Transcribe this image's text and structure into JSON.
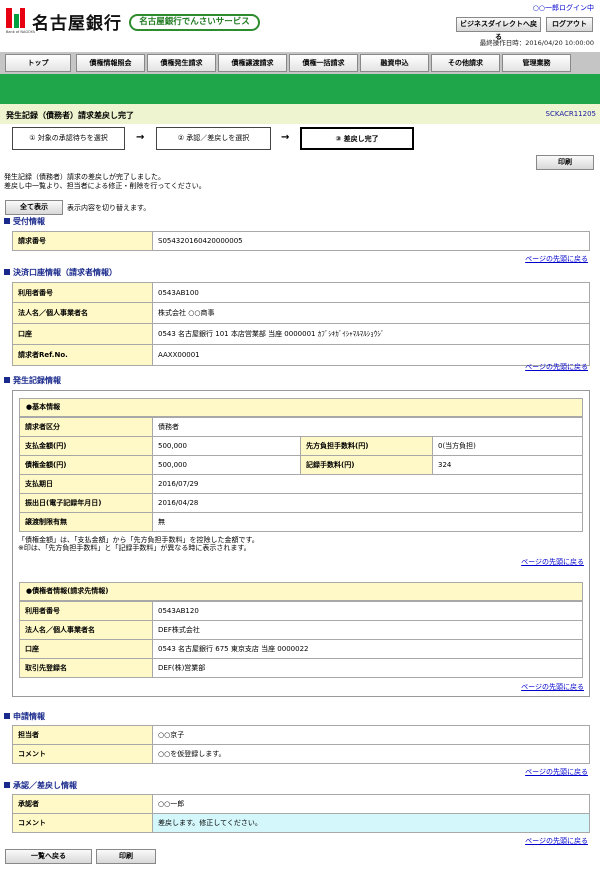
{
  "header": {
    "bank_name": "名古屋銀行",
    "bank_en": "Bank of NAGOYA",
    "service": "名古屋銀行でんさいサービス",
    "user": "○○一郎ログイン中",
    "btn_direct": "ビジネスダイレクトへ戻る",
    "btn_logout": "ログアウト",
    "last_op": "最終操作日時：2016/04/20 10:00:00"
  },
  "tabs": [
    "トップ",
    "債権情報照会",
    "債権発生請求",
    "債権譲渡請求",
    "債権一括請求",
    "融資申込",
    "その他請求",
    "管理業務"
  ],
  "title": {
    "text": "発生記録（債務者）請求差戻し完了",
    "code": "SCKACR11205"
  },
  "steps": [
    "① 対象の承認待ちを選択",
    "② 承認／差戻しを選択",
    "③ 差戻し完了"
  ],
  "arrow": "→",
  "print_label": "印刷",
  "message": [
    "発生記録（債務者）請求の差戻しが完了しました。",
    "差戻し中一覧より、担当者による修正・削除を行ってください。"
  ],
  "toggle": {
    "button": "全て表示",
    "text": "表示内容を切り替えます。"
  },
  "page_top": "ページの先頭に戻る",
  "reception": {
    "title": "受付情報",
    "rows": [
      {
        "label": "請求番号",
        "value": "S054320160420000005"
      }
    ]
  },
  "settlement": {
    "title": "決済口座情報（請求者情報）",
    "rows": [
      {
        "label": "利用者番号",
        "value": "0543AB100"
      },
      {
        "label": "法人名／個人事業者名",
        "value": "株式会社 ○○商事"
      },
      {
        "label": "口座",
        "value": "0543 名古屋銀行 101 本店営業部 当座 0000001 ｶﾌﾞｼｷｶﾞｲｼｬﾏﾙﾏﾙｼｮｳｼﾞ"
      },
      {
        "label": "請求者Ref.No.",
        "value": "AAXX00001"
      }
    ]
  },
  "record": {
    "title": "発生記録情報",
    "basic": {
      "head": "●基本情報",
      "claim_type": {
        "label": "請求者区分",
        "value": "債務者"
      },
      "pay_amount": {
        "label": "支払金額(円)",
        "value": "500,000"
      },
      "fee_payer": {
        "label": "先方負担手数料(円)",
        "value": "0(当方負担)"
      },
      "debt_amount": {
        "label": "債権金額(円)",
        "value": "500,000"
      },
      "record_fee": {
        "label": "記録手数料(円)",
        "value": "324"
      },
      "pay_date": {
        "label": "支払期日",
        "value": "2016/07/29"
      },
      "issue_date": {
        "label": "振出日(電子記録年月日)",
        "value": "2016/04/28"
      },
      "transfer_limit": {
        "label": "譲渡制限有無",
        "value": "無"
      },
      "notes": [
        "「債権金額」は、「支払金額」から「先方負担手数料」を控除した金額です。",
        "※印は、「先方負担手数料」と「記録手数料」が異なる時に表示されます。"
      ]
    },
    "creditor": {
      "head": "●債権者情報(請求先情報)",
      "rows": [
        {
          "label": "利用者番号",
          "value": "0543AB120"
        },
        {
          "label": "法人名／個人事業者名",
          "value": "DEF株式会社"
        },
        {
          "label": "口座",
          "value": "0543 名古屋銀行 675 東京支店 当座 0000022"
        },
        {
          "label": "取引先登録名",
          "value": "DEF(株)営業部"
        }
      ]
    }
  },
  "application": {
    "title": "申請情報",
    "rows": [
      {
        "label": "担当者",
        "value": "○○京子"
      },
      {
        "label": "コメント",
        "value": "○○を仮登録します。"
      }
    ]
  },
  "approval": {
    "title": "承認／差戻し情報",
    "rows": [
      {
        "label": "承認者",
        "value": "○○一郎"
      },
      {
        "label": "コメント",
        "value": "差戻します。修正してください。"
      }
    ]
  },
  "footer": {
    "back": "一覧へ戻る",
    "print": "印刷"
  },
  "colors": {
    "green": "#1fa64a",
    "label_bg": "#fff9c7",
    "comment_bg": "#d3f7fb",
    "link": "#0000cc"
  }
}
